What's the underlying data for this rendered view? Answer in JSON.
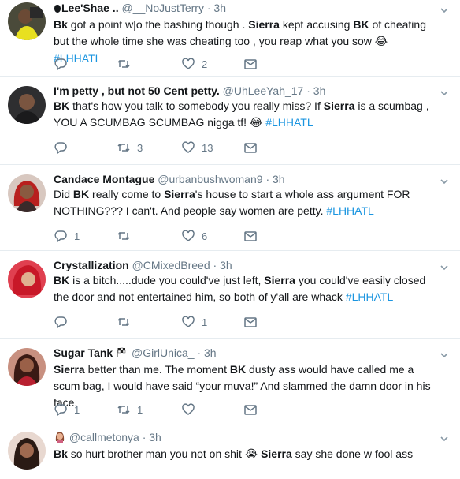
{
  "tweets": [
    {
      "name": "Lee'Shae ..",
      "handle": "@__NoJustTerry",
      "time": "3h",
      "segments": [
        {
          "t": "b",
          "v": "Bk"
        },
        {
          "t": "n",
          "v": " got a point w|o the bashing though . "
        },
        {
          "t": "b",
          "v": "Sierra"
        },
        {
          "t": "n",
          "v": " kept accusing "
        },
        {
          "t": "b",
          "v": "BK"
        },
        {
          "t": "n",
          "v": " of cheating but the whole time she was cheating too , you reap what you sow "
        },
        {
          "t": "e",
          "v": "😂"
        },
        {
          "t": "n",
          "v": " "
        },
        {
          "t": "h",
          "v": "#LHHATL"
        }
      ],
      "replies": "",
      "retweets": "",
      "likes": "2"
    },
    {
      "name": "I'm petty , but not 50 Cent petty.",
      "handle": "@UhLeeYah_17",
      "time": "3h",
      "segments": [
        {
          "t": "b",
          "v": "BK"
        },
        {
          "t": "n",
          "v": " that's how you talk to somebody you really miss? If "
        },
        {
          "t": "b",
          "v": "Sierra"
        },
        {
          "t": "n",
          "v": " is a scumbag , YOU A SCUMBAG SCUMBAG nigga tf! "
        },
        {
          "t": "e",
          "v": "😂"
        },
        {
          "t": "n",
          "v": " "
        },
        {
          "t": "h",
          "v": "#LHHATL"
        }
      ],
      "replies": "",
      "retweets": "3",
      "likes": "13"
    },
    {
      "name": "Candace Montague",
      "handle": "@urbanbushwoman9",
      "time": "3h",
      "segments": [
        {
          "t": "n",
          "v": "Did "
        },
        {
          "t": "b",
          "v": "BK"
        },
        {
          "t": "n",
          "v": " really come to "
        },
        {
          "t": "b",
          "v": "Sierra"
        },
        {
          "t": "n",
          "v": "'s house to start a whole ass argument FOR NOTHING??? I can't. And people say women are petty. "
        },
        {
          "t": "h",
          "v": "#LHHATL"
        }
      ],
      "replies": "1",
      "retweets": "",
      "likes": "6"
    },
    {
      "name": "Crystallization",
      "handle": "@CMixedBreed",
      "time": "3h",
      "segments": [
        {
          "t": "b",
          "v": "BK"
        },
        {
          "t": "n",
          "v": " is a bitch.....dude you could've just left, "
        },
        {
          "t": "b",
          "v": "Sierra"
        },
        {
          "t": "n",
          "v": " you could've easily closed the door and not entertained him, so both of y'all are whack "
        },
        {
          "t": "h",
          "v": "#LHHATL"
        }
      ],
      "replies": "",
      "retweets": "",
      "likes": "1"
    },
    {
      "name": "Sugar Tank",
      "handle": "@GirlUnica_",
      "time": "3h",
      "segments": [
        {
          "t": "b",
          "v": "Sierra"
        },
        {
          "t": "n",
          "v": " better than me. The moment "
        },
        {
          "t": "b",
          "v": "BK"
        },
        {
          "t": "n",
          "v": " dusty ass would have called me a scum bag, I would have said “your muva!” And slammed the damn door in his face."
        }
      ],
      "replies": "1",
      "retweets": "1",
      "likes": ""
    },
    {
      "name": "",
      "handle": "@callmetonya",
      "time": "3h",
      "segments": [
        {
          "t": "b",
          "v": "Bk"
        },
        {
          "t": "n",
          "v": " so hurt brother man you not on shit "
        },
        {
          "t": "e",
          "v": "😭"
        },
        {
          "t": "n",
          "v": " "
        },
        {
          "t": "b",
          "v": "Sierra"
        },
        {
          "t": "n",
          "v": " say she done w fool ass"
        }
      ],
      "replies": "",
      "retweets": "",
      "likes": ""
    }
  ],
  "header_dot": "·",
  "colors": {
    "name": "#14171a",
    "muted": "#657786",
    "link": "#1b95e0",
    "divider": "#e6ecf0"
  },
  "icons": [
    "reply-icon",
    "retweet-icon",
    "like-icon",
    "message-icon",
    "chevron-down-icon"
  ]
}
